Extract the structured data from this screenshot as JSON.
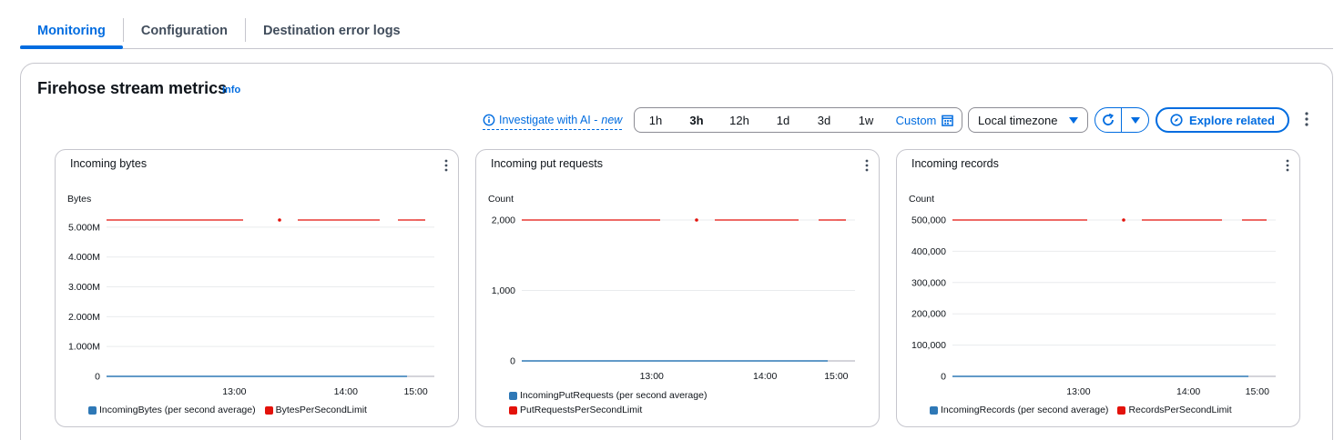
{
  "tabs": [
    {
      "label": "Monitoring",
      "active": true
    },
    {
      "label": "Configuration",
      "active": false
    },
    {
      "label": "Destination error logs",
      "active": false
    }
  ],
  "panel": {
    "title": "Firehose stream metrics",
    "info": "Info"
  },
  "toolbar": {
    "investigate_label": "Investigate with AI -",
    "investigate_new": "new",
    "ranges": [
      "1h",
      "3h",
      "12h",
      "1d",
      "3d",
      "1w"
    ],
    "selected_range": "3h",
    "custom_label": "Custom",
    "timezone": "Local timezone",
    "explore_label": "Explore related",
    "icons": {
      "investigate": "info-circle-icon",
      "calendar": "calendar-icon",
      "refresh": "refresh-icon",
      "explore": "compass-icon"
    }
  },
  "colors": {
    "accent": "#006ce0",
    "series_blue": "#2e78b6",
    "series_red": "#e3120b",
    "grid": "#e9ebed"
  },
  "chart_data": [
    {
      "type": "line",
      "title": "Incoming bytes",
      "ylabel": "Bytes",
      "x_ticks": [
        "13:00",
        "14:00",
        "15:00"
      ],
      "y_ticks": [
        "0",
        "1.000M",
        "2.000M",
        "3.000M",
        "4.000M",
        "5.000M"
      ],
      "ylim": [
        0,
        5240000
      ],
      "series": [
        {
          "name": "IncomingBytes (per second average)",
          "color": "#2e78b6",
          "values": [
            0,
            0
          ]
        },
        {
          "name": "BytesPerSecondLimit",
          "color": "#e3120b",
          "values": [
            5240000,
            5240000
          ]
        }
      ]
    },
    {
      "type": "line",
      "title": "Incoming put requests",
      "ylabel": "Count",
      "x_ticks": [
        "13:00",
        "14:00",
        "15:00"
      ],
      "y_ticks": [
        "0",
        "1,000",
        "2,000"
      ],
      "ylim": [
        0,
        2000
      ],
      "series": [
        {
          "name": "IncomingPutRequests (per second average)",
          "color": "#2e78b6",
          "values": [
            0,
            0
          ]
        },
        {
          "name": "PutRequestsPerSecondLimit",
          "color": "#e3120b",
          "values": [
            2000,
            2000
          ]
        }
      ]
    },
    {
      "type": "line",
      "title": "Incoming records",
      "ylabel": "Count",
      "x_ticks": [
        "13:00",
        "14:00",
        "15:00"
      ],
      "y_ticks": [
        "0",
        "100,000",
        "200,000",
        "300,000",
        "400,000",
        "500,000"
      ],
      "ylim": [
        0,
        500000
      ],
      "series": [
        {
          "name": "IncomingRecords (per second average)",
          "color": "#2e78b6",
          "values": [
            0,
            0
          ]
        },
        {
          "name": "RecordsPerSecondLimit",
          "color": "#e3120b",
          "values": [
            500000,
            500000
          ]
        }
      ]
    }
  ]
}
